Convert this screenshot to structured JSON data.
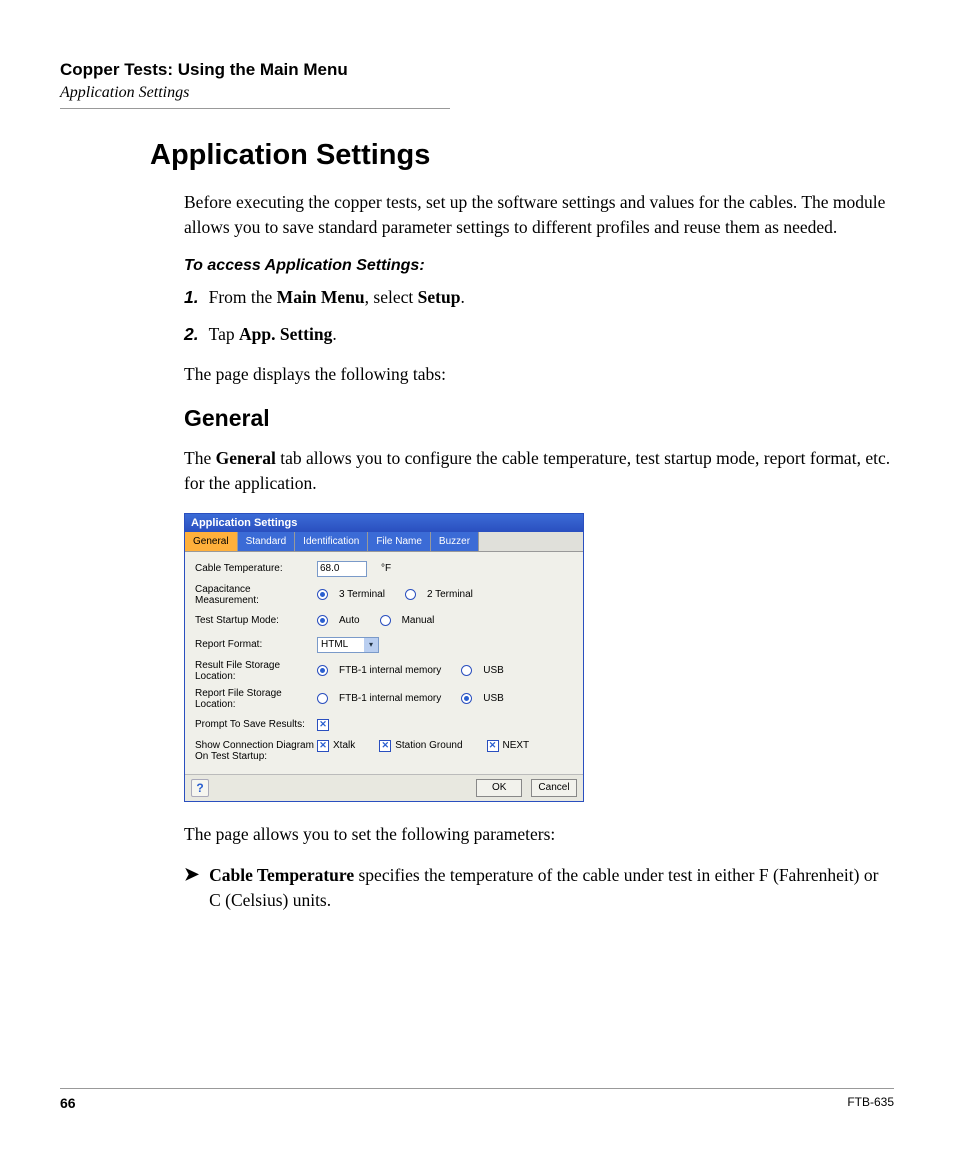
{
  "header": {
    "chapter": "Copper Tests: Using the Main Menu",
    "breadcrumb": "Application Settings"
  },
  "headings": {
    "h1": "Application Settings",
    "h2_general": "General"
  },
  "paragraphs": {
    "intro": "Before executing the copper tests, set up the software settings and values for the cables. The module allows you to save standard parameter settings to different profiles and reuse them as needed.",
    "procedure_heading": "To access Application Settings:",
    "tabs_note": "The page displays the following tabs:",
    "general_before": "The ",
    "general_bold": "General",
    "general_after": " tab allows you to configure the cable temperature, test startup mode, report format, etc. for the application.",
    "params_intro": "The page allows you to set the following parameters:"
  },
  "steps": [
    {
      "num": "1.",
      "before": "From the ",
      "b1": "Main Menu",
      "mid": ", select ",
      "b2": "Setup",
      "after": "."
    },
    {
      "num": "2.",
      "before": "Tap ",
      "b1": "App. Setting",
      "mid": "",
      "b2": "",
      "after": "."
    }
  ],
  "bullet": {
    "b": "Cable Temperature",
    "rest": " specifies the temperature of the cable under test in either F (Fahrenheit) or C (Celsius) units."
  },
  "dialog": {
    "title": "Application Settings",
    "tabs": [
      "General",
      "Standard",
      "Identification",
      "File Name",
      "Buzzer"
    ],
    "labels": {
      "cable_temp": "Cable Temperature:",
      "cap_meas": "Capacitance Measurement:",
      "startup": "Test Startup Mode:",
      "report_fmt": "Report Format:",
      "result_loc": "Result File Storage Location:",
      "report_loc": "Report File Storage Location:",
      "prompt_save": "Prompt To Save Results:",
      "show_diag1": "Show Connection Diagram",
      "show_diag2": "On Test Startup:"
    },
    "values": {
      "cable_temp": "68.0",
      "cable_temp_unit": "°F",
      "cap_opt1": "3 Terminal",
      "cap_opt2": "2 Terminal",
      "startup_opt1": "Auto",
      "startup_opt2": "Manual",
      "report_fmt": "HTML",
      "storage_opt1": "FTB-1 internal memory",
      "storage_opt2": "USB",
      "diag_opt1": "Xtalk",
      "diag_opt2": "Station Ground",
      "diag_opt3": "NEXT"
    },
    "buttons": {
      "ok": "OK",
      "cancel": "Cancel"
    }
  },
  "footer": {
    "page": "66",
    "doc": "FTB-635"
  }
}
